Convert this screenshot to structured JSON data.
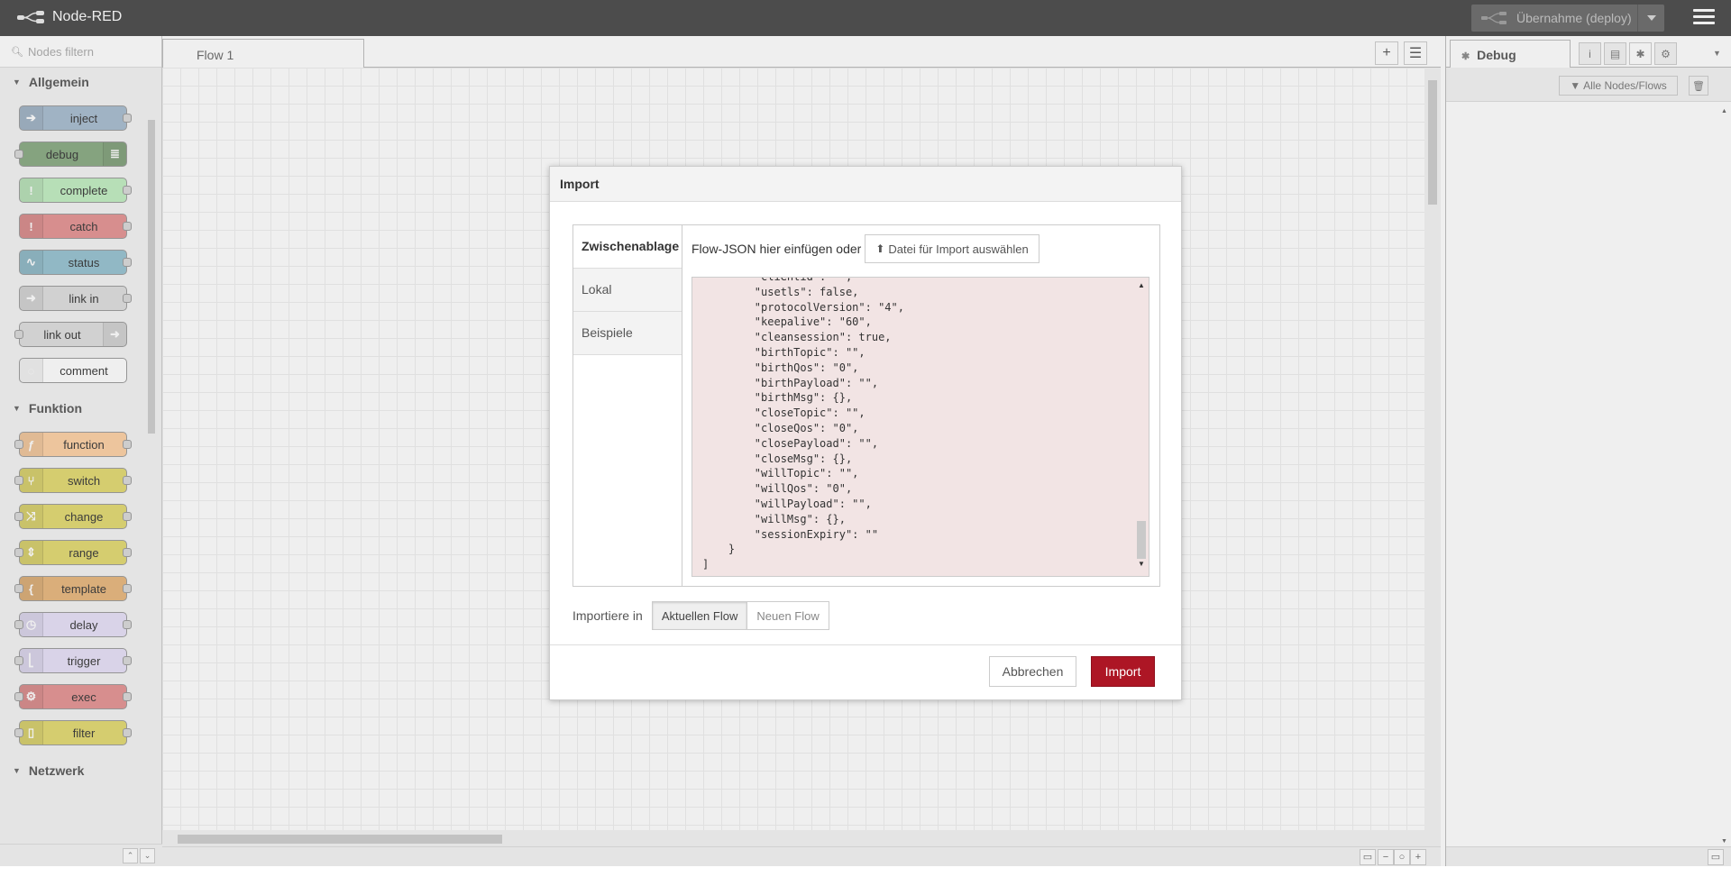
{
  "header": {
    "app_title": "Node-RED",
    "deploy_label": "Übernahme (deploy)"
  },
  "palette": {
    "search_placeholder": "Nodes filtern",
    "categories": [
      {
        "label": "Allgemein",
        "nodes": [
          {
            "label": "inject",
            "color": "#a6bbcf",
            "icon": "arrow-right-icon",
            "glyph": "➔",
            "icon_side": "left",
            "in": false,
            "out": true
          },
          {
            "label": "debug",
            "color": "#87a980",
            "icon": "list-icon",
            "glyph": "≣",
            "icon_side": "right",
            "in": true,
            "out": false
          },
          {
            "label": "complete",
            "color": "#c0edc0",
            "icon": "exclamation-icon",
            "glyph": "!",
            "icon_side": "left",
            "in": false,
            "out": true
          },
          {
            "label": "catch",
            "color": "#e49191",
            "icon": "exclamation-icon",
            "glyph": "!",
            "icon_side": "left",
            "in": false,
            "out": true
          },
          {
            "label": "status",
            "color": "#94c1d0",
            "icon": "pulse-icon",
            "glyph": "∿",
            "icon_side": "left",
            "in": false,
            "out": true
          },
          {
            "label": "link in",
            "color": "#dddddd",
            "icon": "link-in-icon",
            "glyph": "➜",
            "icon_side": "left",
            "in": false,
            "out": true
          },
          {
            "label": "link out",
            "color": "#dddddd",
            "icon": "link-out-icon",
            "glyph": "➜",
            "icon_side": "right",
            "in": true,
            "out": false
          },
          {
            "label": "comment",
            "color": "#ffffff",
            "icon": "comment-icon",
            "glyph": "◌",
            "icon_side": "left",
            "in": false,
            "out": false
          }
        ]
      },
      {
        "label": "Funktion",
        "nodes": [
          {
            "label": "function",
            "color": "#fdd0a2",
            "icon": "function-icon",
            "glyph": "ƒ",
            "icon_side": "left",
            "in": true,
            "out": true
          },
          {
            "label": "switch",
            "color": "#e2d96e",
            "icon": "switch-icon",
            "glyph": "⑂",
            "icon_side": "left",
            "in": true,
            "out": true
          },
          {
            "label": "change",
            "color": "#e2d96e",
            "icon": "shuffle-icon",
            "glyph": "⤨",
            "icon_side": "left",
            "in": true,
            "out": true
          },
          {
            "label": "range",
            "color": "#e2d96e",
            "icon": "range-icon",
            "glyph": "⇕",
            "icon_side": "left",
            "in": true,
            "out": true
          },
          {
            "label": "template",
            "color": "#e7b57a",
            "icon": "brace-icon",
            "glyph": "{",
            "icon_side": "left",
            "in": true,
            "out": true
          },
          {
            "label": "delay",
            "color": "#e6e0f8",
            "icon": "timer-icon",
            "glyph": "◷",
            "icon_side": "left",
            "in": true,
            "out": true
          },
          {
            "label": "trigger",
            "color": "#e6e0f8",
            "icon": "trigger-icon",
            "glyph": "⎣",
            "icon_side": "left",
            "in": true,
            "out": true
          },
          {
            "label": "exec",
            "color": "#e49191",
            "icon": "gear-icon",
            "glyph": "⚙",
            "icon_side": "left",
            "in": true,
            "out": true
          },
          {
            "label": "filter",
            "color": "#e2d96e",
            "icon": "filter-icon",
            "glyph": "▯",
            "icon_side": "left",
            "in": true,
            "out": true
          }
        ]
      },
      {
        "label": "Netzwerk",
        "nodes": []
      }
    ]
  },
  "workspace": {
    "tab_label": "Flow 1"
  },
  "sidebar": {
    "tab_label": "Debug",
    "filter_label": "Alle Nodes/Flows"
  },
  "dialog": {
    "title": "Import",
    "tabs": [
      "Zwischenablage",
      "Lokal",
      "Beispiele"
    ],
    "paste_label": "Flow-JSON hier einfügen oder",
    "file_button": "Datei für Import auswählen",
    "json_text": "        \"clientid\": \"\",\n        \"usetls\": false,\n        \"protocolVersion\": \"4\",\n        \"keepalive\": \"60\",\n        \"cleansession\": true,\n        \"birthTopic\": \"\",\n        \"birthQos\": \"0\",\n        \"birthPayload\": \"\",\n        \"birthMsg\": {},\n        \"closeTopic\": \"\",\n        \"closeQos\": \"0\",\n        \"closePayload\": \"\",\n        \"closeMsg\": {},\n        \"willTopic\": \"\",\n        \"willQos\": \"0\",\n        \"willPayload\": \"\",\n        \"willMsg\": {},\n        \"sessionExpiry\": \"\"\n    }\n]",
    "import_to_label": "Importiere in",
    "current_flow": "Aktuellen Flow",
    "new_flow": "Neuen Flow",
    "cancel": "Abbrechen",
    "import": "Import"
  },
  "colors": {
    "header_bg": "#4c4c4c",
    "primary_button": "#ad1625",
    "json_area_bg": "#f2e4e4"
  }
}
